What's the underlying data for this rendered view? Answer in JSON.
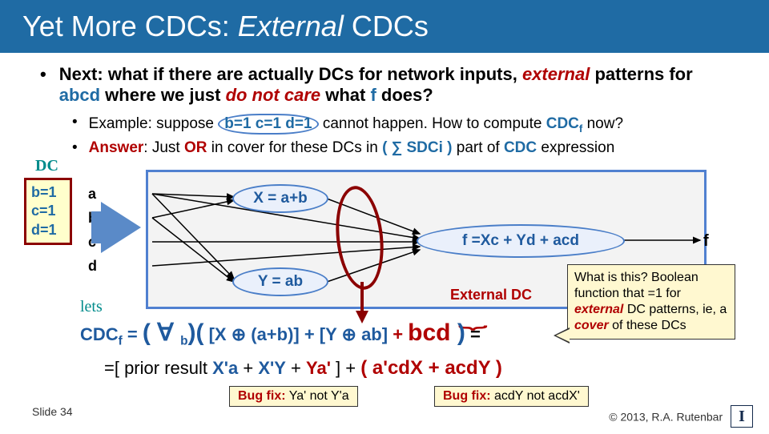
{
  "title": {
    "pre": "Yet More CDCs:  ",
    "italic": "External",
    "post": " CDCs"
  },
  "bullet1": {
    "pre": "Next: what if there are actually DCs for network inputs, ",
    "external": "external",
    "mid": " patterns for ",
    "abcd": "abcd",
    "mid2": " where we just ",
    "dontcare": "do not care",
    "mid3": " what ",
    "f": "f",
    "post": " does?"
  },
  "sub1": {
    "pre": "Example:  suppose ",
    "circ": "b=1 c=1 d=1",
    "mid": " cannot happen.  How to compute ",
    "cdc": "CDC",
    "sub": "f",
    "post": "  now?"
  },
  "sub2": {
    "ans": "Answer",
    "mid1": ": Just ",
    "or": "OR",
    "mid2": " in cover for these DCs in ",
    "sig": "( ∑ SDCi )",
    "mid3": " part of ",
    "cdc": "CDC",
    "post": " expression"
  },
  "dcbox": {
    "head": "DC",
    "l1": "b=1",
    "l2": "c=1",
    "l3": "d=1",
    "pen": "DC"
  },
  "inputs": {
    "a": "a",
    "b": "b",
    "c": "c",
    "d": "d"
  },
  "bubbles": {
    "x": "X = a+b",
    "y": "Y = ab",
    "f": "f =Xc + Yd + acd"
  },
  "fout": "f",
  "lets": "lets",
  "extdc": "External DC",
  "callout": {
    "l1": "What is this?  Boolean function that =1 for ",
    "ext": "external",
    "l2": " DC patterns, ie, a ",
    "cov": "cover",
    "l3": " of these DCs"
  },
  "eq1": {
    "cdc": "CDC",
    "sub": "f",
    "eq": " = ",
    "forall": "( ∀ ",
    "b": "b",
    "close1": ")(",
    "terms": " [X ⊕ (a+b)] + [Y ⊕ ab]",
    "plus": "  + ",
    "bcd": "bcd",
    "close2": " )",
    "eq2": " ="
  },
  "eq2": {
    "pre": "=[ prior result ",
    "t1": "X'a",
    "p1": "  +  ",
    "t2": "X'Y",
    "p2": " + ",
    "t3": "Ya'",
    "post1": "   ]  +  ",
    "open": "( ",
    "r1": "a'cdX + acdY",
    "close": " )"
  },
  "bugfix1": {
    "lab": "Bug fix:",
    "txt": "  Ya' not Y'a"
  },
  "bugfix2": {
    "lab": "Bug fix:",
    "txt": "  acdY not acdX'"
  },
  "footer": {
    "slide": "Slide 34",
    "copy": "© 2013, R.A. Rutenbar"
  }
}
